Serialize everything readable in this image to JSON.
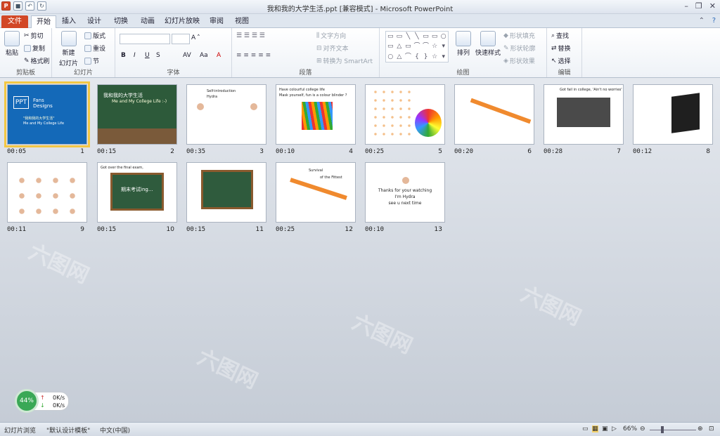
{
  "window": {
    "title": "我和我的大学生活.ppt [兼容模式] - Microsoft PowerPoint"
  },
  "quick_access": {
    "app_icon": "P",
    "undo": "↶",
    "redo": "↻"
  },
  "tabs": [
    "文件",
    "开始",
    "插入",
    "设计",
    "切换",
    "动画",
    "幻灯片放映",
    "审阅",
    "视图"
  ],
  "ribbon": {
    "clipboard": {
      "label": "剪贴板",
      "paste": "粘贴",
      "cut": "剪切",
      "copy": "复制",
      "format_painter": "格式刷"
    },
    "slides": {
      "label": "幻灯片",
      "new_slide": "新建",
      "new_slide2": "幻灯片",
      "layout": "版式",
      "reset": "重设",
      "section": "节"
    },
    "font": {
      "label": "字体",
      "size": "A",
      "bold": "B",
      "italic": "I",
      "underline": "U",
      "strike": "S",
      "spacing": "AV",
      "case": "Aa",
      "color": "A"
    },
    "paragraph": {
      "label": "段落",
      "text_direction": "文字方向",
      "align_text": "对齐文本",
      "smartart": "转换为 SmartArt"
    },
    "drawing": {
      "label": "绘图",
      "arrange": "排列",
      "quick_styles": "快速样式",
      "fill": "形状填充",
      "outline": "形状轮廓",
      "effects": "形状效果"
    },
    "editing": {
      "label": "编辑",
      "find": "查找",
      "replace": "替换",
      "select": "选择"
    }
  },
  "slides": [
    {
      "num": "1",
      "time": "00:05",
      "title": "PPT",
      "subtitle": "Fans Designs",
      "line1": "\"我和我的大学生活\"",
      "line2": "Me and My College Life"
    },
    {
      "num": "2",
      "time": "00:15",
      "title": "我和我的大学生活",
      "subtitle": "Me and My College Life :-)"
    },
    {
      "num": "3",
      "time": "00:35",
      "title": "Self-introduction",
      "subtitle": "Hydra"
    },
    {
      "num": "4",
      "time": "00:10",
      "title": "Have colourful college life",
      "subtitle": "Mask yourself, fun is a colour blinder ?"
    },
    {
      "num": "5",
      "time": "00:25",
      "title": "",
      "subtitle": ""
    },
    {
      "num": "6",
      "time": "00:20",
      "title": "",
      "subtitle": ""
    },
    {
      "num": "7",
      "time": "00:28",
      "title": "Got fail in college, 'Ain't no worries'",
      "subtitle": ""
    },
    {
      "num": "8",
      "time": "00:12",
      "title": "",
      "subtitle": ""
    },
    {
      "num": "9",
      "time": "00:11",
      "title": "",
      "subtitle": ""
    },
    {
      "num": "10",
      "time": "00:15",
      "title": "Got over the final exam,",
      "subtitle": "期末考试ing..."
    },
    {
      "num": "11",
      "time": "00:15",
      "title": "",
      "subtitle": ""
    },
    {
      "num": "12",
      "time": "00:25",
      "title": "Survival",
      "subtitle": "of the Fittest"
    },
    {
      "num": "13",
      "time": "00:10",
      "title": "Thanks for your watching",
      "subtitle": "I'm Hydra",
      "line1": "see u next time"
    }
  ],
  "statusbar": {
    "view": "幻灯片浏览",
    "theme": "\"默认设计模板\"",
    "language": "中文(中国)",
    "zoom": "66%",
    "minus": "⊖",
    "plus": "⊕"
  },
  "network": {
    "percent": "44%",
    "up": "0K/s",
    "down": "0K/s"
  },
  "watermark": "六图网"
}
